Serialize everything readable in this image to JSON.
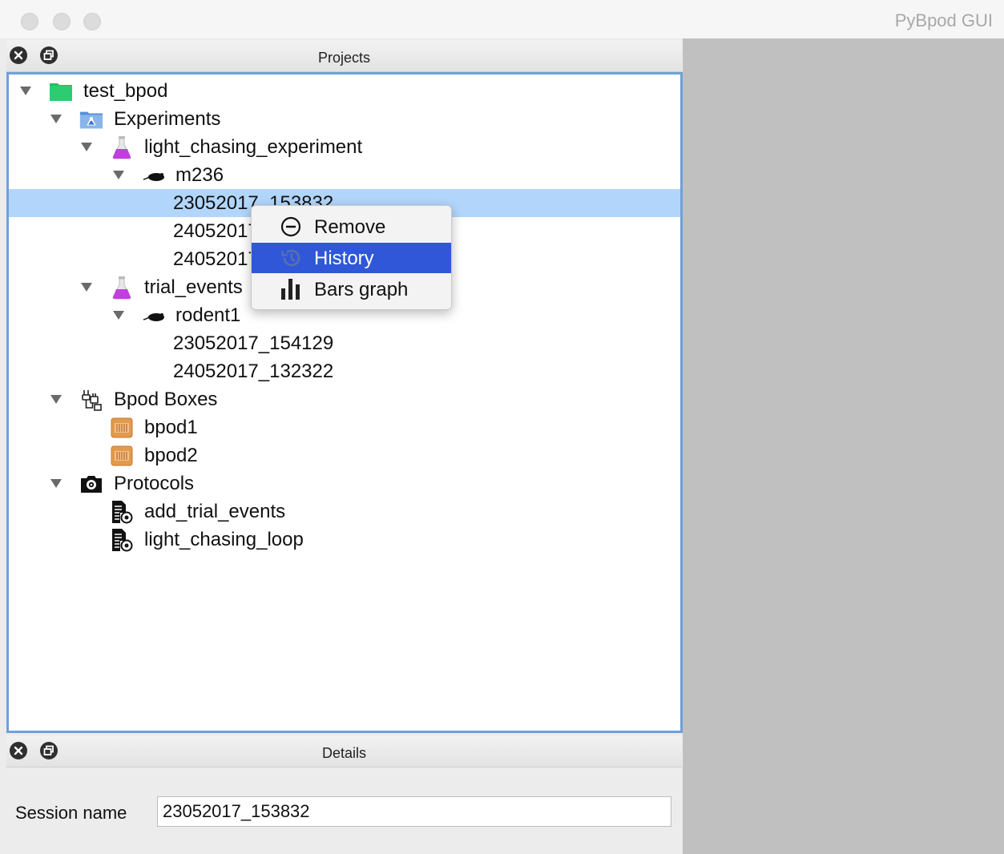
{
  "window": {
    "title": "PyBpod GUI"
  },
  "projects_panel": {
    "title": "Projects"
  },
  "tree": {
    "project": "test_bpod",
    "experiments": "Experiments",
    "experiment1": "light_chasing_experiment",
    "subject1": "m236",
    "s1": "23052017_153832",
    "s2": "24052017",
    "s3": "24052017",
    "experiment2": "trial_events",
    "subject2": "rodent1",
    "s4": "23052017_154129",
    "s5": "24052017_132322",
    "boxes": "Bpod Boxes",
    "box1": "bpod1",
    "box2": "bpod2",
    "protocols": "Protocols",
    "p1": "add_trial_events",
    "p2": "light_chasing_loop"
  },
  "context_menu": {
    "remove": "Remove",
    "history": "History",
    "bars_graph": "Bars graph"
  },
  "details_panel": {
    "title": "Details",
    "session_name_label": "Session name",
    "session_name_value": "23052017_153832"
  },
  "colors": {
    "selection": "#b2d6fb",
    "menu_highlight": "#2f57d8",
    "focus_border": "#6fa0dd"
  }
}
